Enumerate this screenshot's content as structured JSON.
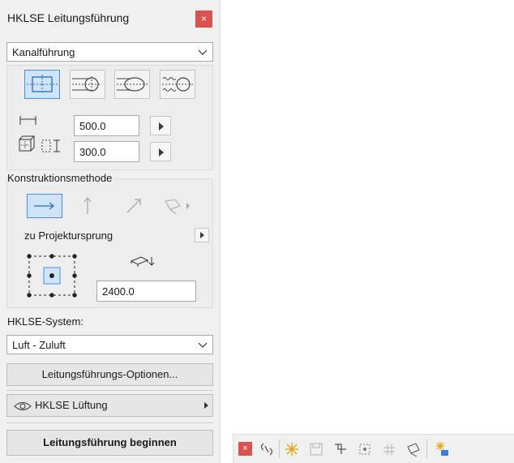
{
  "window": {
    "title": "HKLSE Leitungsführung",
    "close_label": "×"
  },
  "routing_mode": {
    "selected": "Kanalführung"
  },
  "geometry": {
    "width_value": "500.0",
    "height_value": "300.0"
  },
  "construction": {
    "heading": "Konstruktionsmethode",
    "reference_label": "zu Projektursprung",
    "elevation_value": "2400.0"
  },
  "system": {
    "label": "HKLSE-System:",
    "selected": "Luft - Zuluft"
  },
  "buttons": {
    "options_label": "Leitungsführungs-Optionen...",
    "layer_label": "HKLSE Lüftung",
    "begin_label": "Leitungsführung beginnen"
  },
  "toolbar": {
    "close_label": "×"
  },
  "colors": {
    "accent_blue": "#4a90d9",
    "selected_fill": "#cfe4f8",
    "close_red": "#d9534f",
    "panel_bg": "#f0f0f0"
  }
}
